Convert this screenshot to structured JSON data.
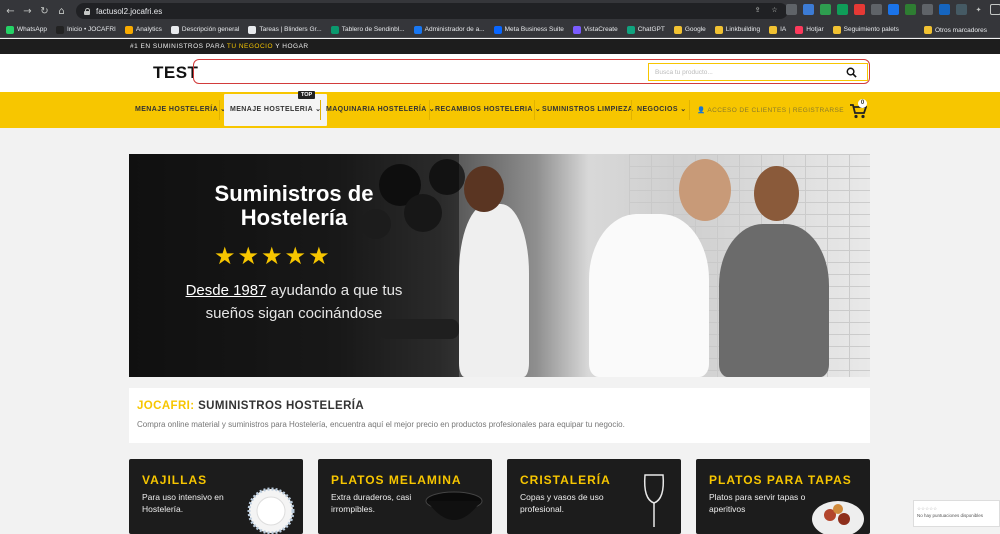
{
  "browser": {
    "url": "factusol2.jocafri.es",
    "bookmarks": [
      {
        "label": "WhatsApp",
        "color": "#25d366"
      },
      {
        "label": "Inicio • JOCAFRI",
        "color": "#222222"
      },
      {
        "label": "Analytics",
        "color": "#f9ab00"
      },
      {
        "label": "Descripción general",
        "color": "#e8eaed"
      },
      {
        "label": "Tareas | Blinders Gr...",
        "color": "#e8eaed"
      },
      {
        "label": "Tablero de Sendinbl...",
        "color": "#0b996e"
      },
      {
        "label": "Administrador de a...",
        "color": "#1877f2"
      },
      {
        "label": "Meta Business Suite",
        "color": "#0866ff"
      },
      {
        "label": "VistaCreate",
        "color": "#7b5cff"
      },
      {
        "label": "ChatGPT",
        "color": "#10a37f"
      },
      {
        "label": "Google",
        "color": "#f1c232"
      },
      {
        "label": "Linkbuilding",
        "color": "#f1c232"
      },
      {
        "label": "IA",
        "color": "#f1c232"
      },
      {
        "label": "Hotjar",
        "color": "#fd3a5c"
      },
      {
        "label": "Seguimiento palets",
        "color": "#f1c232"
      }
    ],
    "other_bookmarks": "Otros marcadores"
  },
  "site": {
    "topbar": {
      "prefix": "#1 EN SUMINISTROS PARA ",
      "highlight": "TU NEGOCIO",
      "suffix": " Y HOGAR"
    },
    "logo": "TEST",
    "search": {
      "placeholder": "Busca tu producto..."
    },
    "nav": {
      "items": [
        "MENAJE HOSTELERÍA",
        "MENAJE HOSTELERIA",
        "MAQUINARIA HOSTELERÍA",
        "RECAMBIOS HOSTELERIA",
        "SUMINISTROS LIMPIEZA",
        "NEGOCIOS"
      ],
      "top_badge": "TOP",
      "account": "ACCESO DE CLIENTES | REGISTRARSE",
      "cart_count": "0"
    },
    "hero": {
      "title": "Suministros de Hostelería",
      "stars": "★★★★★",
      "sub_underlined": "Desde 1987",
      "sub_rest": " ayudando a que tus sueños sigan cocinándose"
    },
    "intro": {
      "title_highlight": "JOCAFRI:",
      "title_rest": " SUMINISTROS HOSTELERÍA",
      "text": "Compra online material y suministros para Hostelería, encuentra aquí el mejor precio en productos profesionales para equipar tu negocio."
    },
    "cards": [
      {
        "title": "VAJILLAS",
        "text": "Para uso intensivo en Hostelería."
      },
      {
        "title": "PLATOS MELAMINA",
        "text": "Extra duraderos, casi irrompibles."
      },
      {
        "title": "CRISTALERÍA",
        "text": "Copas y vasos de uso profesional."
      },
      {
        "title": "PLATOS PARA TAPAS",
        "text": "Platos para servir tapas o aperitivos"
      }
    ],
    "rating_widget": {
      "stars": "☆☆☆☆☆",
      "text": "No hay puntuaciones disponibles"
    },
    "colors": {
      "accent": "#f7c600",
      "dark": "#1c1c1c"
    }
  }
}
